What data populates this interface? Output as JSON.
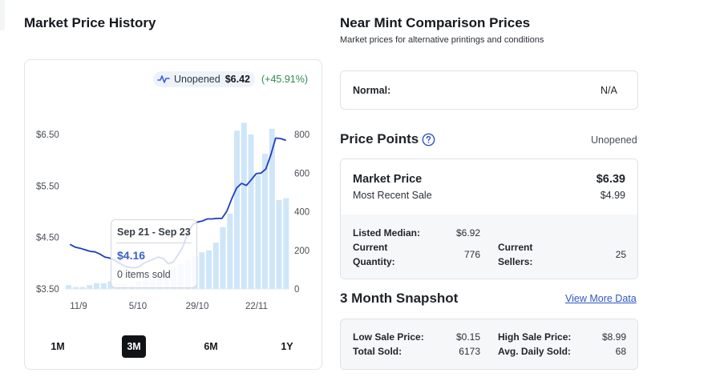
{
  "left": {
    "title": "Market Price History",
    "badge": {
      "label": "Unopened",
      "value": "$6.42",
      "change": "(+45.91%)"
    },
    "tooltip": {
      "range": "Sep 21 - Sep 23",
      "price": "$4.16",
      "sold": "0 items sold"
    },
    "ranges": [
      "1M",
      "3M",
      "6M",
      "1Y"
    ],
    "active_range": "3M"
  },
  "chart_data": {
    "type": "line",
    "x_ticks": [
      "11/9",
      "5/10",
      "29/10",
      "22/11"
    ],
    "y_left_ticks": [
      "$6.50",
      "$5.50",
      "$4.50",
      "$3.50"
    ],
    "y_left_range": [
      3.5,
      6.5
    ],
    "y_right_ticks": [
      "800",
      "600",
      "400",
      "200",
      "0"
    ],
    "y_right_range": [
      0,
      800
    ],
    "series": [
      {
        "kind": "line",
        "axis": "left",
        "color": "#1e3dbf",
        "values": [
          4.36,
          4.31,
          4.29,
          4.26,
          4.23,
          4.22,
          4.18,
          4.12,
          4.1,
          4.06,
          4.0,
          3.95,
          3.92,
          3.91,
          3.93,
          4.0,
          4.04,
          4.08,
          4.12,
          4.09,
          3.99,
          4.02,
          4.16,
          4.32,
          4.58,
          4.75,
          4.8,
          4.82,
          4.86,
          4.86,
          4.87,
          4.87,
          5.01,
          5.25,
          5.46,
          5.55,
          5.51,
          5.62,
          5.74,
          5.75,
          5.83,
          6.1,
          6.43,
          6.42,
          6.39
        ]
      },
      {
        "kind": "bar",
        "axis": "right",
        "color": "#cfe6f9",
        "values": [
          20,
          10,
          10,
          20,
          30,
          30,
          40,
          30,
          25,
          20,
          40,
          50,
          60,
          80,
          90,
          110,
          130,
          150,
          170,
          190,
          200,
          240,
          320,
          390,
          820,
          860,
          800,
          590,
          700,
          830,
          460,
          470
        ]
      }
    ],
    "grid": false
  },
  "right": {
    "title": "Near Mint Comparison Prices",
    "subtitle": "Market prices for alternative printings and conditions",
    "normal": {
      "label": "Normal:",
      "value": "N/A"
    },
    "price_points": {
      "title": "Price Points",
      "type": "Unopened",
      "market_price_label": "Market Price",
      "market_price": "$6.39",
      "recent_sale_label": "Most Recent Sale",
      "recent_sale": "$4.99",
      "listed_median_label": "Listed Median:",
      "listed_median": "$6.92",
      "current_quantity_label_1": "Current",
      "current_quantity_label_2": "Quantity:",
      "current_quantity": "776",
      "current_sellers_label_1": "Current",
      "current_sellers_label_2": "Sellers:",
      "current_sellers": "25"
    },
    "snapshot": {
      "title": "3 Month Snapshot",
      "link": "View More Data",
      "low_sale_label": "Low Sale Price:",
      "low_sale": "$0.15",
      "high_sale_label": "High Sale Price:",
      "high_sale": "$8.99",
      "total_sold_label": "Total Sold:",
      "total_sold": "6173",
      "avg_daily_label": "Avg. Daily Sold:",
      "avg_daily": "68"
    }
  },
  "colors": {
    "line": "#1e3dbf",
    "bars": "#cfe6f9",
    "positive": "#2e8b4f",
    "link": "#2f56c7",
    "active_btn": "#111317"
  }
}
